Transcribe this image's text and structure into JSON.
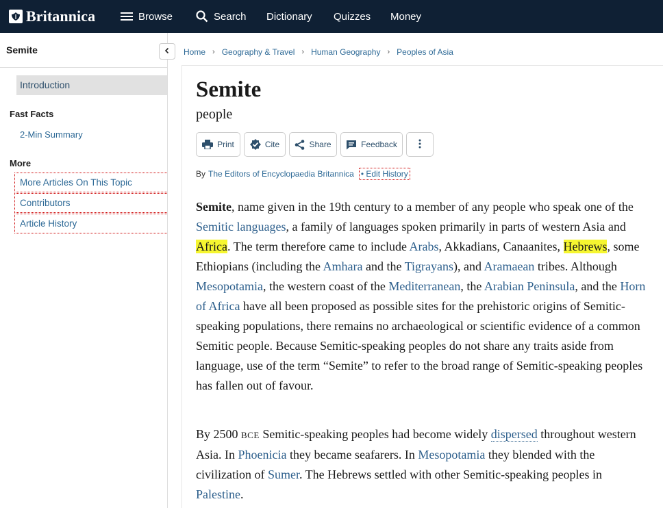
{
  "nav": {
    "logo_text": "Britannica",
    "browse": "Browse",
    "search": "Search",
    "dictionary": "Dictionary",
    "quizzes": "Quizzes",
    "money": "Money"
  },
  "sidebar": {
    "title": "Semite",
    "introduction": "Introduction",
    "fast_facts_heading": "Fast Facts",
    "summary_link": "2-Min Summary",
    "more_heading": "More",
    "more_links": [
      "More Articles On This Topic",
      "Contributors",
      "Article History"
    ]
  },
  "breadcrumb": [
    "Home",
    "Geography & Travel",
    "Human Geography",
    "Peoples of Asia"
  ],
  "article": {
    "title": "Semite",
    "subtitle": "people",
    "buttons": {
      "print": "Print",
      "cite": "Cite",
      "share": "Share",
      "feedback": "Feedback"
    },
    "byline_prefix": "By",
    "author": "The Editors of Encyclopaedia Britannica",
    "edit_history": "• Edit History",
    "p1": {
      "bold_term": "Semite",
      "t1": ", name given in the 19th century to a member of any people who speak one of the ",
      "l_semitic_languages": "Semitic languages",
      "t2": ", a family of languages spoken primarily in parts of western Asia and ",
      "l_africa": "Africa",
      "t3": ". The term therefore came to include ",
      "l_arabs": "Arabs",
      "t4": ", Akkadians, Canaanites, ",
      "l_hebrews": "Hebrews",
      "t5": ", some Ethiopians (including the ",
      "l_amhara": "Amhara",
      "t6": " and the ",
      "l_tigrayans": "Tigrayans",
      "t7": "), and ",
      "l_aramaean": "Aramaean",
      "t8": " tribes. Although ",
      "l_mesopotamia": "Mesopotamia",
      "t9": ", the western coast of the ",
      "l_mediterranean": "Mediterranean",
      "t10": ", the ",
      "l_arabian_peninsula": "Arabian Peninsula",
      "t11": ", and the ",
      "l_horn_of_africa": "Horn of Africa",
      "t12": " have all been proposed as possible sites for the prehistoric origins of Semitic-speaking populations, there remains no archaeological or scientific evidence of a common Semitic people. Because Semitic-speaking peoples do not share any traits aside from language, use of the term “Semite” to refer to the broad range of Semitic-speaking peoples has fallen out of favour."
    },
    "p2": {
      "t1": "By 2500 ",
      "era": "BCE",
      "t2": " Semitic-speaking peoples had become widely ",
      "l_dispersed": "dispersed",
      "t3": " throughout western Asia. In ",
      "l_phoenicia": "Phoenicia",
      "t4": " they became seafarers. In ",
      "l_mesopotamia": "Mesopotamia",
      "t5": " they blended with the civilization of ",
      "l_sumer": "Sumer",
      "t6": ". The Hebrews settled with other Semitic-speaking peoples in ",
      "l_palestine": "Palestine",
      "t7": "."
    }
  },
  "colors": {
    "nav_bg": "#0f2034",
    "link": "#2d5f8c",
    "highlight": "#f6f630",
    "active_bg": "#e1e1e1"
  },
  "icons": [
    "britannica-logo-icon",
    "menu-icon",
    "search-icon",
    "chevron-left-icon",
    "chevron-right-icon",
    "printer-icon",
    "cite-badge-icon",
    "share-icon",
    "feedback-icon",
    "more-vertical-icon"
  ]
}
